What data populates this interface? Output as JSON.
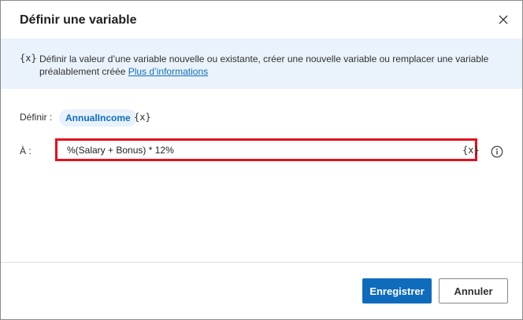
{
  "dialog": {
    "title": "Définir une variable"
  },
  "info": {
    "icon": "{x}",
    "text": "Définir la valeur d’une variable nouvelle ou existante, créer une nouvelle variable ou remplacer une variable préalablement créée ",
    "link": "Plus d’informations"
  },
  "form": {
    "set_label": "Définir :",
    "variable_name": "AnnualIncome",
    "variable_icon": "{x}",
    "to_label": "À :",
    "value": "%(Salary + Bonus) * 12%",
    "value_icon": "{x}"
  },
  "buttons": {
    "save": "Enregistrer",
    "cancel": "Annuler"
  },
  "colors": {
    "accent": "#0f6cbd",
    "banner": "#eaf3fc",
    "highlight": "#e3101f"
  }
}
